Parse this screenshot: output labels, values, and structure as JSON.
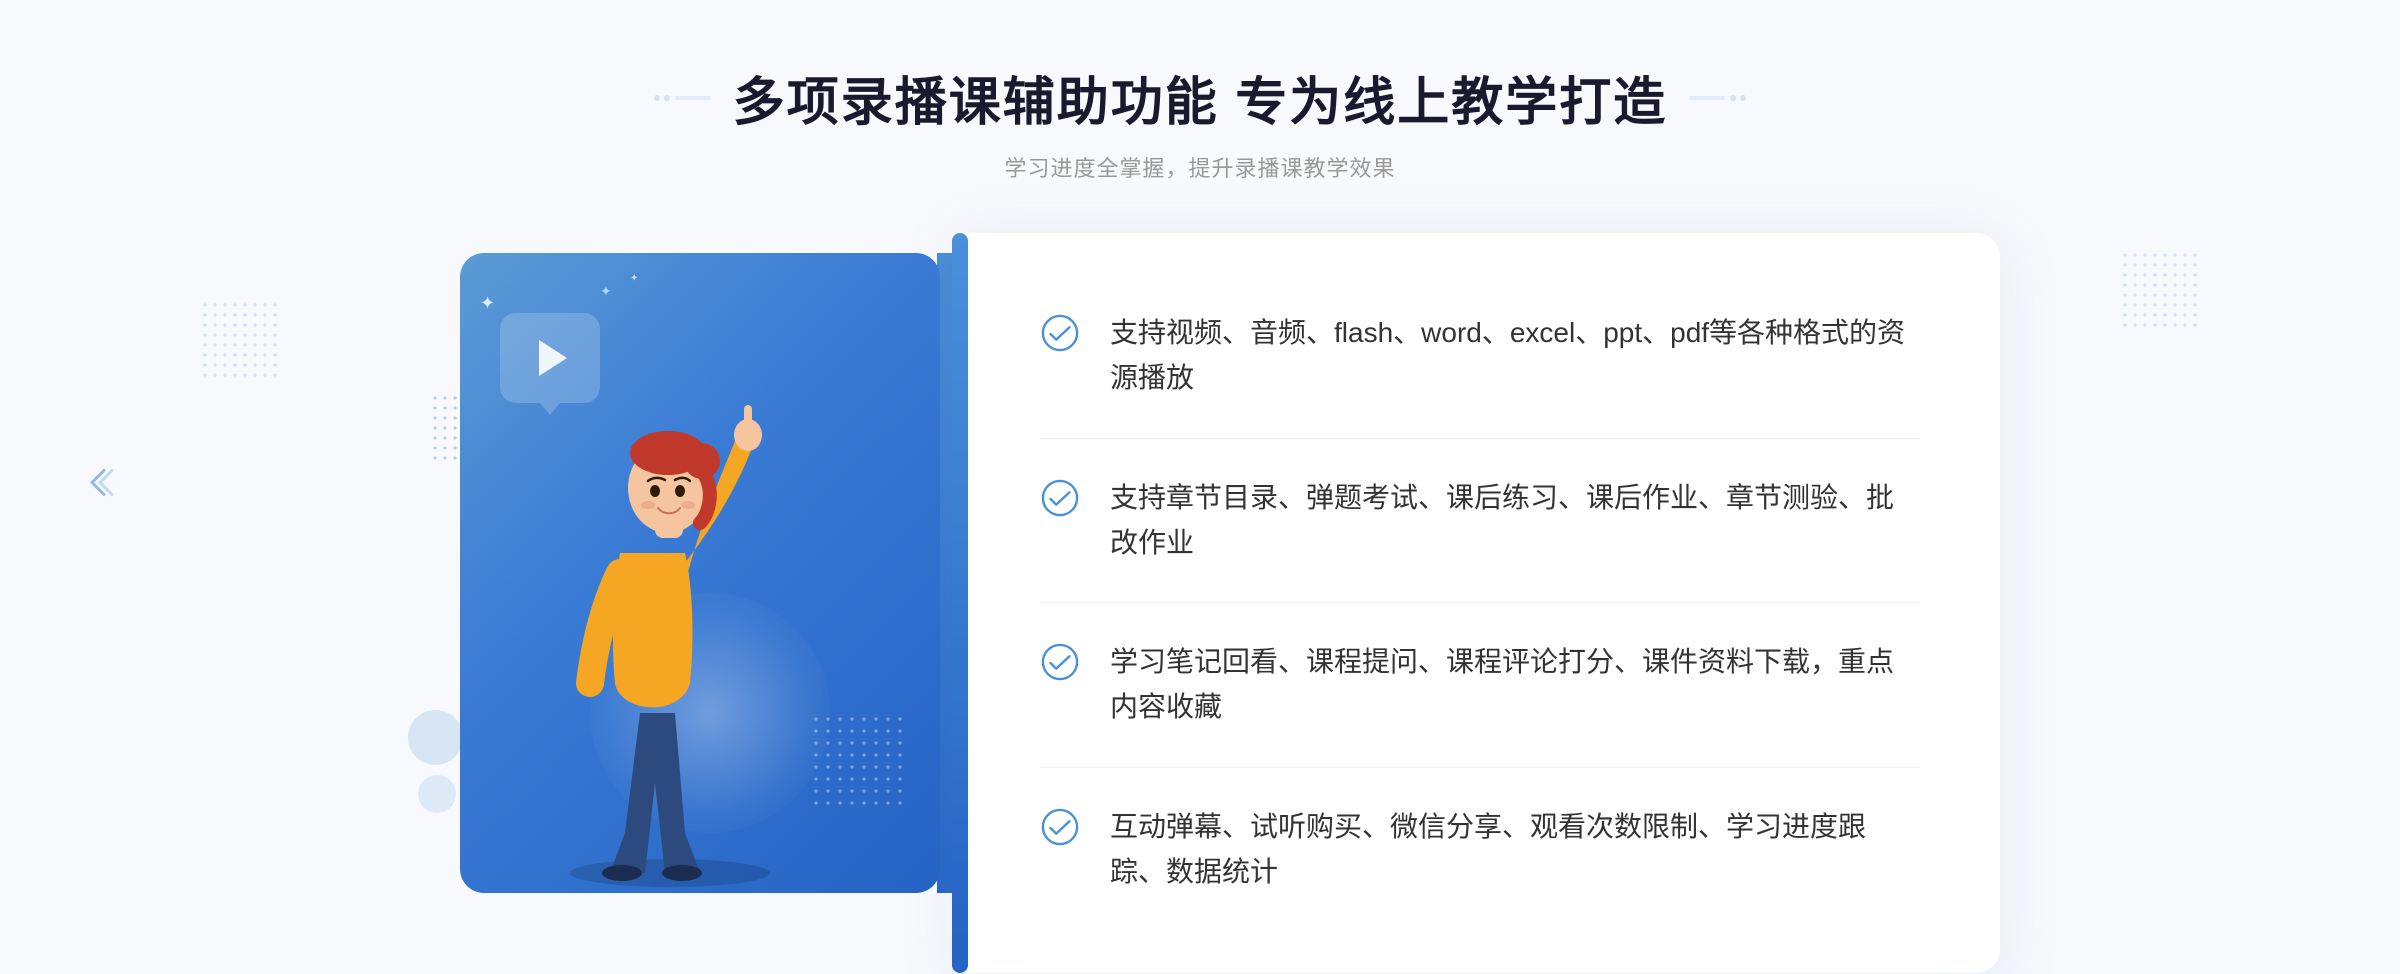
{
  "header": {
    "title": "多项录播课辅助功能 专为线上教学打造",
    "subtitle": "学习进度全掌握，提升录播课教学效果",
    "decorator_dots": "···"
  },
  "features": [
    {
      "id": 1,
      "text": "支持视频、音频、flash、word、excel、ppt、pdf等各种格式的资源播放"
    },
    {
      "id": 2,
      "text": "支持章节目录、弹题考试、课后练习、课后作业、章节测验、批改作业"
    },
    {
      "id": 3,
      "text": "学习笔记回看、课程提问、课程评论打分、课件资料下载，重点内容收藏"
    },
    {
      "id": 4,
      "text": "互动弹幕、试听购买、微信分享、观看次数限制、学习进度跟踪、数据统计"
    }
  ],
  "colors": {
    "primary_blue": "#3a7bd5",
    "light_blue": "#5b9bd5",
    "dark_blue": "#2563c4",
    "text_dark": "#1a1a2e",
    "text_gray": "#999999",
    "text_body": "#333333"
  }
}
